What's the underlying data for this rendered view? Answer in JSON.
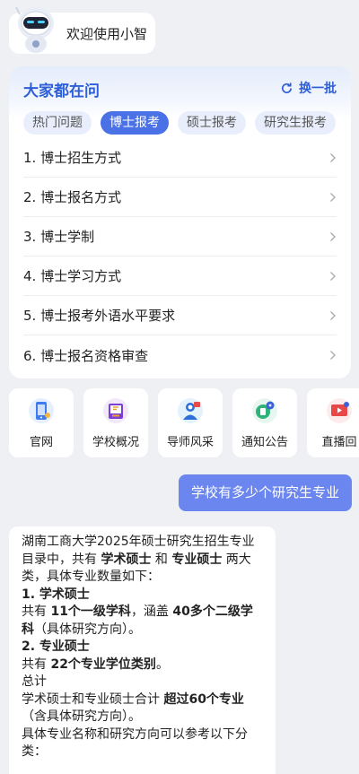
{
  "greeting": {
    "text": "欢迎使用小智"
  },
  "questions": {
    "title": "大家都在问",
    "refresh_label": "换一批",
    "tabs": [
      "热门问题",
      "博士报考",
      "硕士报考",
      "研究生报考"
    ],
    "active_tab": "博士报考",
    "items": [
      "1. 博士招生方式",
      "2. 博士报名方式",
      "3. 博士学制",
      "4. 博士学习方式",
      "5. 博士报考外语水平要求",
      "6. 博士报名资格审查"
    ]
  },
  "quick_links": [
    {
      "label": "官网",
      "icon": "phone-icon"
    },
    {
      "label": "学校概况",
      "icon": "book-icon"
    },
    {
      "label": "导师风采",
      "icon": "teacher-icon"
    },
    {
      "label": "通知公告",
      "icon": "notice-icon"
    },
    {
      "label": "直播回",
      "icon": "live-icon"
    }
  ],
  "user_message": "学校有多少个研究生专业",
  "answer": {
    "intro_1": "湖南工商大学2025年硕士研究生招生专业目录中，共有 ",
    "intro_b1": "学术硕士",
    "intro_2": " 和 ",
    "intro_b2": "专业硕士",
    "intro_3": " 两大类，具体专业数量如下：",
    "s1_title": "1. 学术硕士",
    "s1_a": "共有 ",
    "s1_b1": "11个一级学科",
    "s1_c": "，涵盖 ",
    "s1_b2": "40多个二级学科",
    "s1_d": "（具体研究方向）。",
    "s2_title": "2. 专业硕士",
    "s2_a": "共有 ",
    "s2_b": "22个专业学位类别",
    "s2_c": "。",
    "total_label": "总计",
    "total_a": "学术硕士和专业硕士合计 ",
    "total_b": "超过60个专业",
    "total_c": "（含具体研究方向）。",
    "more": "具体专业名称和研究方向可以参考以下分类："
  },
  "colors": {
    "accent": "#2d5fd8",
    "tab_active": "#4a72e6",
    "user_bubble": "#6b86ee",
    "background": "#eef0f4"
  }
}
